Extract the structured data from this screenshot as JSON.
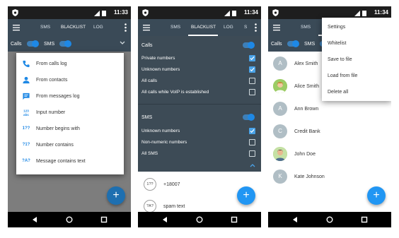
{
  "status": {
    "time1": "11:33",
    "time2": "11:34",
    "time3": "11:34"
  },
  "tabs": {
    "sms": "SMS",
    "blacklist": "BLACKLIST",
    "log": "LOG",
    "s": "S"
  },
  "filter": {
    "calls": "Calls",
    "sms": "SMS"
  },
  "add_dialog": {
    "items": [
      {
        "icon": "phone-icon",
        "label": "From calls log"
      },
      {
        "icon": "person-icon",
        "label": "From contacts"
      },
      {
        "icon": "message-icon",
        "label": "From messages log"
      },
      {
        "icon": "dialpad-icon",
        "glyph": "123\nabc",
        "label": "Input number"
      },
      {
        "icon": "number-begins-icon",
        "glyph": "1??",
        "label": "Number begins with"
      },
      {
        "icon": "number-contains-icon",
        "glyph": "?1?",
        "label": "Number contains"
      },
      {
        "icon": "text-contains-icon",
        "glyph": "?A?",
        "label": "Message contains text"
      }
    ]
  },
  "blacklist_settings": {
    "calls_header": "Calls",
    "calls_rows": [
      {
        "label": "Private numbers",
        "checked": true
      },
      {
        "label": "Unknown numbers",
        "checked": true
      },
      {
        "label": "All calls",
        "checked": false
      },
      {
        "label": "All calls while VoIP is established",
        "checked": false
      }
    ],
    "sms_header": "SMS",
    "sms_rows": [
      {
        "label": "Unknown numbers",
        "checked": true
      },
      {
        "label": "Non-numeric numbers",
        "checked": false
      },
      {
        "label": "All SMS",
        "checked": false
      }
    ]
  },
  "rules": [
    {
      "badge": "1??",
      "label": "+18007"
    },
    {
      "badge": "?A?",
      "label": "spam text"
    }
  ],
  "contacts": [
    {
      "initial": "A",
      "name": "Alex Smith"
    },
    {
      "initial": "",
      "name": "Alice Smith"
    },
    {
      "initial": "A",
      "name": "Ann Brown"
    },
    {
      "initial": "C",
      "name": "Credit Bank"
    },
    {
      "initial": "",
      "name": "John Doe"
    },
    {
      "initial": "K",
      "name": "Kate Johnson"
    }
  ],
  "overflow_menu": [
    "Settings",
    "Whitelist",
    "Save to file",
    "Load from file",
    "Delete all"
  ],
  "fab_label": "+",
  "colors": {
    "appbar": "#3a4a57",
    "accent": "#2196f3",
    "statusbar": "#1e1e1e"
  }
}
